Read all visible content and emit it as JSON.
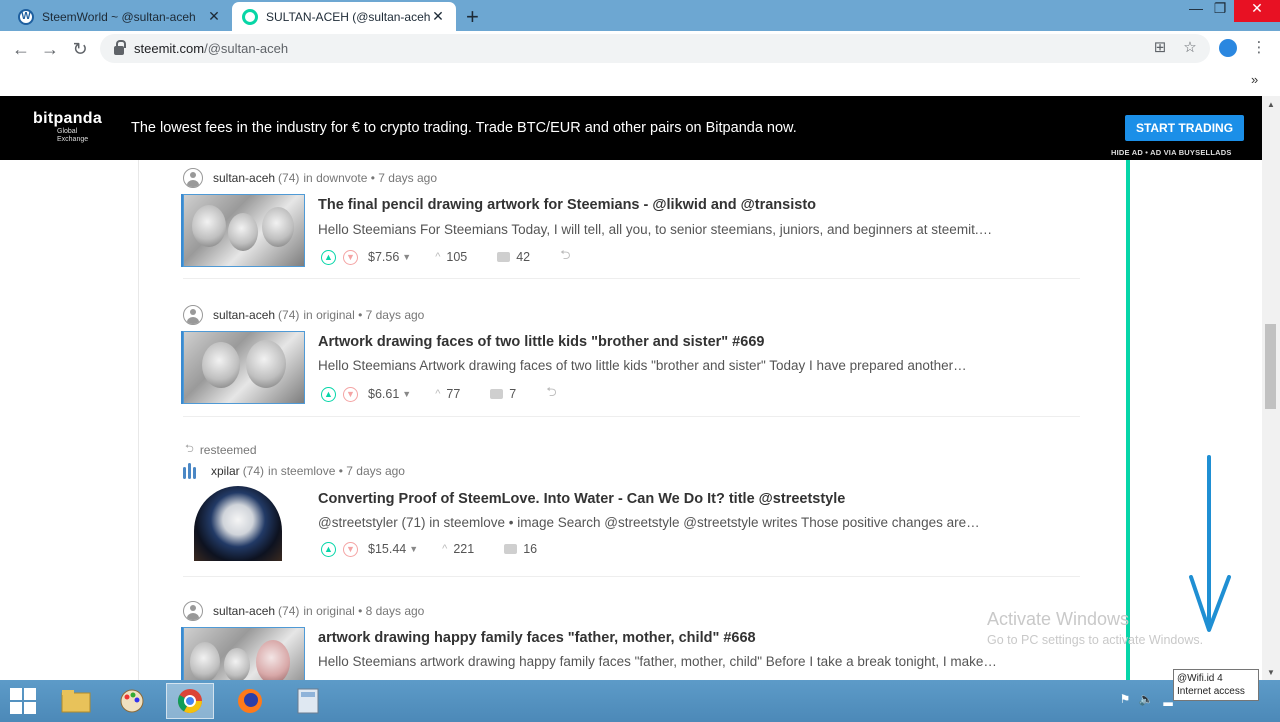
{
  "tabs": [
    {
      "title": "SteemWorld ~ @sultan-aceh",
      "icon": "wordpress-icon"
    },
    {
      "title": "SULTAN-ACEH (@sultan-aceh) —",
      "icon": "steemit-icon"
    }
  ],
  "address_bar": {
    "host": "steemit.com",
    "path": "/@sultan-aceh"
  },
  "ad": {
    "brand": "bitpanda",
    "brand_sub1": "Global",
    "brand_sub2": "Exchange",
    "text": "The lowest fees in the industry for € to crypto trading. Trade BTC/EUR and other pairs on Bitpanda now.",
    "cta": "START TRADING",
    "note": "HIDE AD • AD VIA BUYSELLADS"
  },
  "posts": [
    {
      "author": "sultan-aceh",
      "rep": "(74)",
      "context": "in downvote • 7 days ago",
      "title": "The final pencil drawing artwork for Steemians - @likwid and @transisto",
      "body": "Hello Steemians For Steemians Today, I will tell, all you, to senior steemians, juniors, and beginners at steemit.…",
      "payout": "$7.56",
      "votes": "105",
      "comments": "42"
    },
    {
      "author": "sultan-aceh",
      "rep": "(74)",
      "context": "in original • 7 days ago",
      "title": "Artwork drawing faces of two little kids \"brother and sister\" #669",
      "body": "Hello Steemians Artwork drawing faces of two little kids \"brother and sister\" Today I have prepared another…",
      "payout": "$6.61",
      "votes": "77",
      "comments": "7"
    },
    {
      "resteemed_label": "resteemed",
      "author": "xpilar",
      "rep": "(74)",
      "context": "in steemlove • 7 days ago",
      "title": "Converting Proof of SteemLove. Into Water - Can We Do It? title @streetstyle",
      "body": "@streetstyler (71) in steemlove • image Search @streetstyle @streetstyle writes Those positive changes are…",
      "payout": "$15.44",
      "votes": "221",
      "comments": "16"
    },
    {
      "author": "sultan-aceh",
      "rep": "(74)",
      "context": "in original • 8 days ago",
      "title": "artwork drawing happy family faces \"father, mother, child\" #668",
      "body": "Hello Steemians artwork drawing happy family faces \"father, mother, child\" Before I take a break tonight, I make…"
    }
  ],
  "watermark": {
    "title": "Activate Windows",
    "subtitle": "Go to PC settings to activate Windows."
  },
  "tooltip": {
    "line1": "@Wifi.id  4",
    "line2": "Internet access"
  },
  "colors": {
    "steemit_green": "#06d6a9",
    "ad_blue": "#1b8fe8",
    "tabstrip": "#6da7d2",
    "annotation_arrow": "#1f8fd3"
  }
}
